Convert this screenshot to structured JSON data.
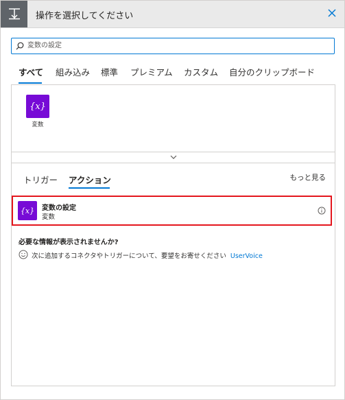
{
  "dialog": {
    "title": "操作を選択してください",
    "header_icon": "trigger-action-icon",
    "close_icon": "close-icon"
  },
  "search": {
    "value": "",
    "placeholder": "変数の設定",
    "icon": "search-icon"
  },
  "tabs": [
    {
      "label": "すべて",
      "active": true
    },
    {
      "label": "組み込み",
      "active": false
    },
    {
      "label": "標準",
      "active": false
    },
    {
      "label": "プレミアム",
      "active": false
    },
    {
      "label": "カスタム",
      "active": false
    },
    {
      "label": "自分のクリップボード",
      "active": false
    }
  ],
  "connectors": [
    {
      "label": "変数",
      "icon": "variable-icon",
      "icon_text": "{x}"
    }
  ],
  "collapse_icon": "chevron-down-icon",
  "subtabs": [
    {
      "label": "トリガー",
      "active": false
    },
    {
      "label": "アクション",
      "active": true
    }
  ],
  "more_link": "もっと見る",
  "actions": [
    {
      "title": "変数の設定",
      "subtitle": "変数",
      "icon": "variable-icon",
      "icon_text": "{x}",
      "info_icon": "info-icon",
      "highlighted": true
    }
  ],
  "missing": {
    "title": "必要な情報が表示されませんか?",
    "text": "次に追加するコネクタやトリガーについて、要望をお寄せください",
    "link": "UserVoice",
    "icon": "smiley-icon"
  },
  "colors": {
    "accent": "#0078d4",
    "variable_icon_bg": "#770bd6",
    "highlight_border": "#e4151c",
    "header_bg": "#eaeaea",
    "header_icon_bg": "#5f6469"
  }
}
